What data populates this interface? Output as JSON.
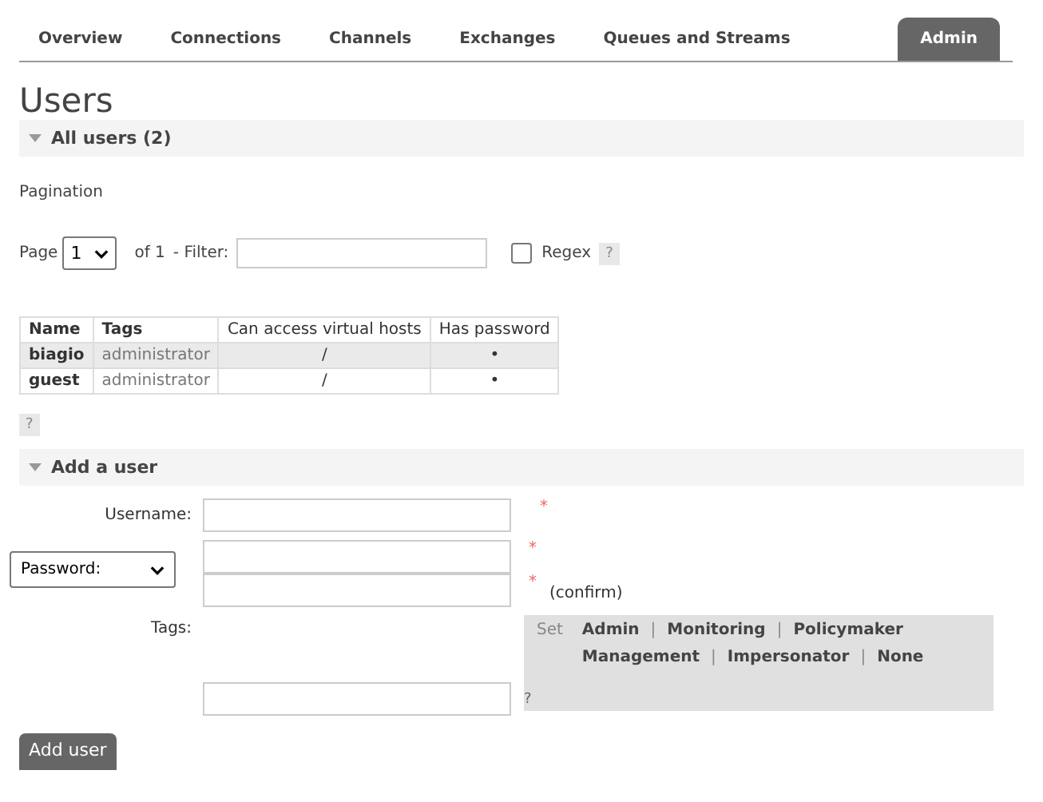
{
  "tabs": [
    {
      "label": "Overview",
      "selected": false
    },
    {
      "label": "Connections",
      "selected": false
    },
    {
      "label": "Channels",
      "selected": false
    },
    {
      "label": "Exchanges",
      "selected": false
    },
    {
      "label": "Queues and Streams",
      "selected": false
    },
    {
      "label": "Admin",
      "selected": true
    }
  ],
  "heading": "Users",
  "all_users": {
    "title": "All users (2)",
    "expanded": true,
    "pagination_label": "Pagination",
    "page_label": "Page",
    "page_value": "1",
    "of": "of 1",
    "filter_label": "- Filter:",
    "regex_label": "Regex",
    "regex_checked": false,
    "help": "?",
    "table": {
      "columns": [
        "Name",
        "Tags",
        "Can access virtual hosts",
        "Has password"
      ],
      "rows": [
        [
          "biagio",
          "administrator",
          "/",
          "•"
        ],
        [
          "guest",
          "administrator",
          "/",
          "•"
        ]
      ]
    },
    "table_help": "?"
  },
  "add_user": {
    "title": "Add a user",
    "expanded": true,
    "username_label": "Username:",
    "required": "*",
    "password_select": "Password:",
    "confirm": "(confirm)",
    "tags_label": "Tags:",
    "set_label": "Set",
    "tag_links": [
      "Admin",
      "Monitoring",
      "Policymaker",
      "Management",
      "Impersonator",
      "None"
    ],
    "separator": "|",
    "tags_help": "?",
    "button": "Add user"
  }
}
